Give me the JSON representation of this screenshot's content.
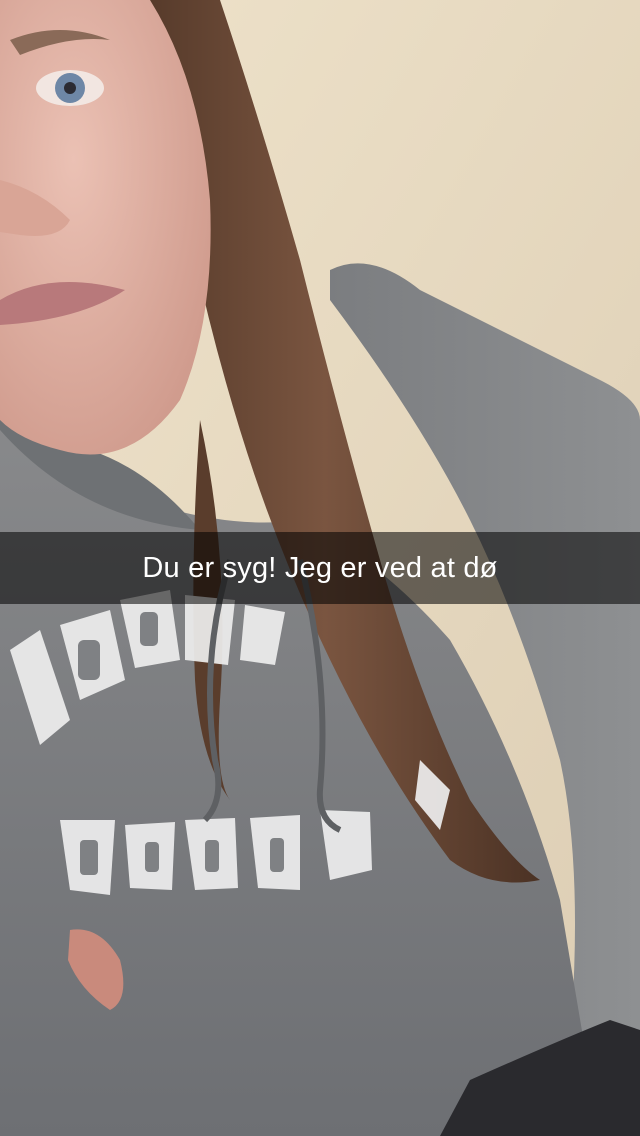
{
  "snap": {
    "caption": "Du er syg! Jeg er ved at dø",
    "caption_bar_color": "#000000",
    "caption_text_color": "#ffffff"
  },
  "photo": {
    "colors": {
      "wall": "#e9dcc4",
      "hoodie": "#7f8184",
      "hair": "#6b4a35",
      "skin": "#e2b3a6"
    },
    "shirt_print_lettering": "ABERCROMBIE & FITCH"
  }
}
